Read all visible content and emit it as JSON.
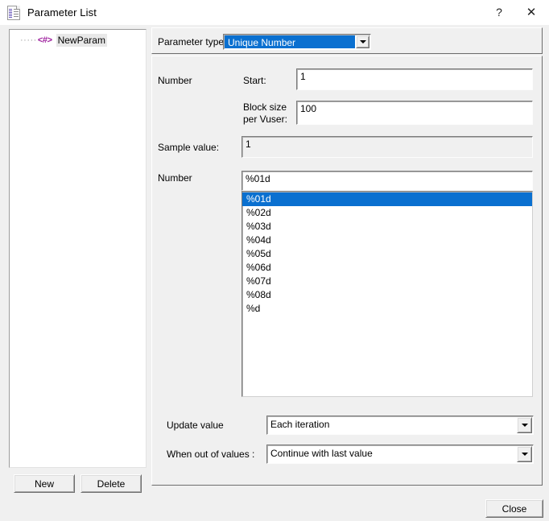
{
  "window": {
    "title": "Parameter List",
    "icon": "parameter-list-icon",
    "help_label": "?",
    "close_label": "✕"
  },
  "tree": {
    "items": [
      {
        "tag": "<#>",
        "label": "NewParam",
        "dots": "·····"
      }
    ]
  },
  "left_buttons": {
    "new_label": "New",
    "delete_label": "Delete"
  },
  "footer": {
    "close_label": "Close"
  },
  "parameter_type": {
    "label": "Parameter type:",
    "value": "Unique Number",
    "options": [
      "Unique Number"
    ]
  },
  "number_section": {
    "group_label": "Number",
    "start_label": "Start:",
    "start_value": "1",
    "block_label_line1": "Block size",
    "block_label_line2": "per Vuser:",
    "block_value": "100"
  },
  "sample": {
    "label": "Sample value:",
    "value": "1"
  },
  "number_format": {
    "label": "Number",
    "edit_value": "%01d",
    "selected_index": 0,
    "options": [
      "%01d",
      "%02d",
      "%03d",
      "%04d",
      "%05d",
      "%06d",
      "%07d",
      "%08d",
      "%d"
    ]
  },
  "update_value": {
    "label": "Update value",
    "value": "Each iteration",
    "options": [
      "Each iteration"
    ]
  },
  "out_of_values": {
    "label": "When out of values :",
    "value": "Continue with last value",
    "options": [
      "Continue with last value"
    ]
  },
  "colors": {
    "selection_blue": "#0a70d0",
    "tree_tag_purple": "#9c1b9c",
    "window_bg": "#f0f0f0"
  }
}
